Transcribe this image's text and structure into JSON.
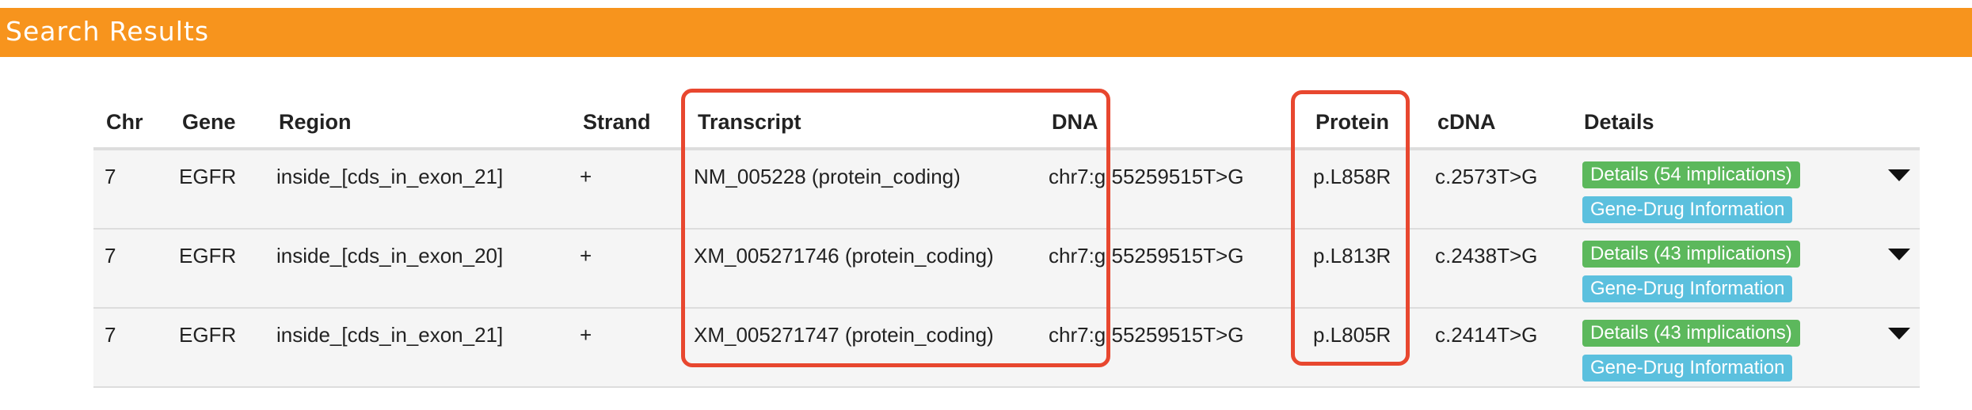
{
  "header": {
    "title": "Search Results"
  },
  "table": {
    "columns": [
      "Chr",
      "Gene",
      "Region",
      "Strand",
      "Transcript",
      "DNA",
      "Protein",
      "cDNA",
      "Details"
    ],
    "rows": [
      {
        "chr": "7",
        "gene": "EGFR",
        "region": "inside_[cds_in_exon_21]",
        "strand": "+",
        "transcript": "NM_005228 (protein_coding)",
        "dna": "chr7:g.55259515T>G",
        "protein": "p.L858R",
        "cdna": "c.2573T>G",
        "details_label": "Details (54 implications)",
        "drug_label": "Gene-Drug Information"
      },
      {
        "chr": "7",
        "gene": "EGFR",
        "region": "inside_[cds_in_exon_20]",
        "strand": "+",
        "transcript": "XM_005271746 (protein_coding)",
        "dna": "chr7:g.55259515T>G",
        "protein": "p.L813R",
        "cdna": "c.2438T>G",
        "details_label": "Details (43 implications)",
        "drug_label": "Gene-Drug Information"
      },
      {
        "chr": "7",
        "gene": "EGFR",
        "region": "inside_[cds_in_exon_21]",
        "strand": "+",
        "transcript": "XM_005271747 (protein_coding)",
        "dna": "chr7:g.55259515T>G",
        "protein": "p.L805R",
        "cdna": "c.2414T>G",
        "details_label": "Details (43 implications)",
        "drug_label": "Gene-Drug Information"
      }
    ]
  },
  "icons": {
    "row_toggle": "caret-down-icon"
  },
  "colors": {
    "header_bar": "#f7941d",
    "details_badge": "#5cb85c",
    "drug_badge": "#5bc0de",
    "highlight_box": "#e8472f"
  }
}
